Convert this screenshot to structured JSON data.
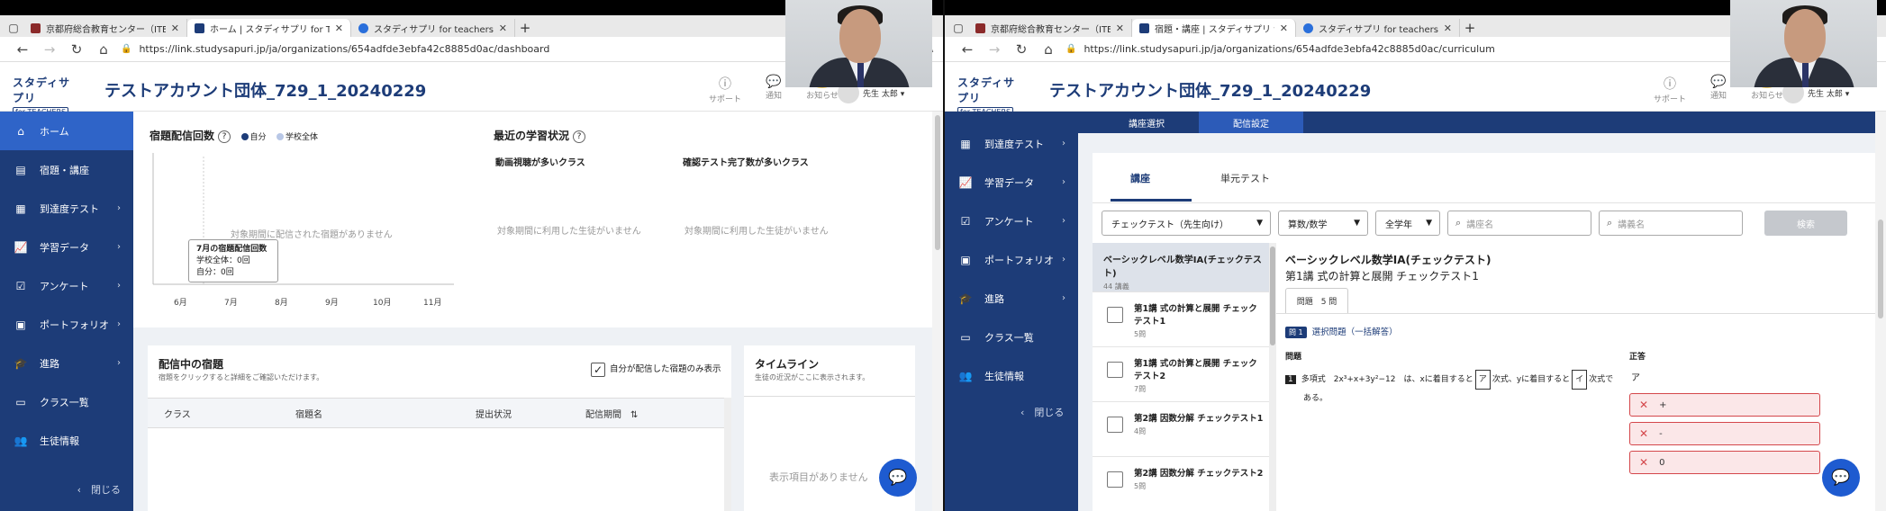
{
  "left": {
    "tabs": [
      {
        "label": "京都府総合教育センター（ITEC）",
        "color": "#8b2a2a",
        "active": false
      },
      {
        "label": "ホーム | スタディサプリ for TEACHERS",
        "color": "#1d3c78",
        "active": true
      },
      {
        "label": "スタディサプリ for teachers ログイン",
        "color": "#2a6fdb",
        "active": false
      }
    ],
    "url": "https://link.studysapuri.jp/ja/organizations/654adfde3ebfa42c8885d0ac/dashboard",
    "logo_main": "スタディサプリ",
    "logo_sub": "for TEACHERS",
    "org_title": "テストアカウント団体_729_1_20240229",
    "header_icons": [
      {
        "icon": "question-icon",
        "label": "サポート"
      },
      {
        "icon": "chat-icon",
        "label": "通知"
      },
      {
        "icon": "bell-icon",
        "label": "お知らせ"
      }
    ],
    "user_label": "先生 太郎 ▾",
    "sidebar": [
      {
        "icon": "home-icon",
        "label": "ホーム",
        "chevron": false,
        "active": true
      },
      {
        "icon": "homework-icon",
        "label": "宿題・講座",
        "chevron": false,
        "active": false
      },
      {
        "icon": "test-icon",
        "label": "到達度テスト",
        "chevron": true,
        "active": false
      },
      {
        "icon": "chart-icon",
        "label": "学習データ",
        "chevron": true,
        "active": false
      },
      {
        "icon": "survey-icon",
        "label": "アンケート",
        "chevron": true,
        "active": false
      },
      {
        "icon": "portfolio-icon",
        "label": "ポートフォリオ",
        "chevron": true,
        "active": false
      },
      {
        "icon": "graduation-icon",
        "label": "進路",
        "chevron": true,
        "active": false
      },
      {
        "icon": "class-icon",
        "label": "クラス一覧",
        "chevron": false,
        "active": false
      },
      {
        "icon": "student-icon",
        "label": "生徒情報",
        "chevron": false,
        "active": false
      }
    ],
    "sidebar_close": "閉じる",
    "homework_chart": {
      "title": "宿題配信回数",
      "legend": [
        "自分",
        "学校全体"
      ],
      "empty": "対象期間に配信された宿題がありません",
      "months": [
        "6月",
        "7月",
        "8月",
        "9月",
        "10月",
        "11月"
      ],
      "tooltip_title": "7月の宿題配信回数",
      "tooltip_line1": "学校全体：0回",
      "tooltip_line2": "自分：0回"
    },
    "recent": {
      "title": "最近の学習状況",
      "col1_title": "動画視聴が多いクラス",
      "col2_title": "確認テスト完了数が多いクラス",
      "empty": "対象期間に利用した生徒がいません"
    },
    "delivering": {
      "title": "配信中の宿題",
      "desc": "宿題をクリックすると詳細をご確認いただけます。",
      "only_mine": "自分が配信した宿題のみ表示",
      "columns": [
        "クラス",
        "宿題名",
        "提出状況",
        "配信期間"
      ]
    },
    "timeline": {
      "title": "タイムライン",
      "desc": "生徒の近況がここに表示されます。",
      "empty": "表示項目がありません"
    }
  },
  "right": {
    "tabs": [
      {
        "label": "京都府総合教育センター（ITEC）",
        "color": "#8b2a2a",
        "active": false
      },
      {
        "label": "宿題・講座 | スタディサプリ for TEACHERS",
        "color": "#1d3c78",
        "active": true
      },
      {
        "label": "スタディサプリ for teachers ログイン",
        "color": "#2a6fdb",
        "active": false
      }
    ],
    "url": "https://link.studysapuri.jp/ja/organizations/654adfde3ebfa42c8885d0ac/curriculum",
    "sidebar": [
      {
        "icon": "test-icon",
        "label": "到達度テスト",
        "chevron": true
      },
      {
        "icon": "chart-icon",
        "label": "学習データ",
        "chevron": true
      },
      {
        "icon": "survey-icon",
        "label": "アンケート",
        "chevron": true
      },
      {
        "icon": "portfolio-icon",
        "label": "ポートフォリオ",
        "chevron": true
      },
      {
        "icon": "graduation-icon",
        "label": "進路",
        "chevron": true
      },
      {
        "icon": "class-icon",
        "label": "クラス一覧",
        "chevron": false
      },
      {
        "icon": "student-icon",
        "label": "生徒情報",
        "chevron": false
      }
    ],
    "top_tabs": [
      "講座選択",
      "配信設定"
    ],
    "sub_tabs": [
      "講座",
      "単元テスト"
    ],
    "filters": {
      "type": "チェックテスト（先生向け）",
      "subject": "算数/数学",
      "grade": "全学年",
      "course_ph": "講座名",
      "lecture_ph": "講義名",
      "search_btn": "検索"
    },
    "course": {
      "title": "ベーシックレベル数学IA(チェックテスト)",
      "count": "44 講義",
      "items": [
        {
          "label": "第1講 式の計算と展開 チェックテスト1",
          "count": "5問"
        },
        {
          "label": "第1講 式の計算と展開 チェックテスト2",
          "count": "7問"
        },
        {
          "label": "第2講 因数分解 チェックテスト1",
          "count": "4問"
        },
        {
          "label": "第2講 因数分解 チェックテスト2",
          "count": "5問"
        }
      ]
    },
    "detail": {
      "title": "ベーシックレベル数学IA(チェックテスト)",
      "subtitle": "第1講 式の計算と展開 チェックテスト1",
      "qtab": "問題　5 問",
      "q_badge": "問 1",
      "q_type": "選択問題（一括解答）",
      "col_q": "問題",
      "col_a": "正答",
      "question_num": "1",
      "question_pre": "多項式　2x³+x+3y²−12　は、xに着目すると",
      "box1": "ア",
      "question_mid": "次式、yに着目すると",
      "box2": "イ",
      "question_post": "次式で",
      "question_end": "ある。",
      "answer": "ア",
      "choices": [
        "+",
        "-",
        "0"
      ]
    }
  }
}
